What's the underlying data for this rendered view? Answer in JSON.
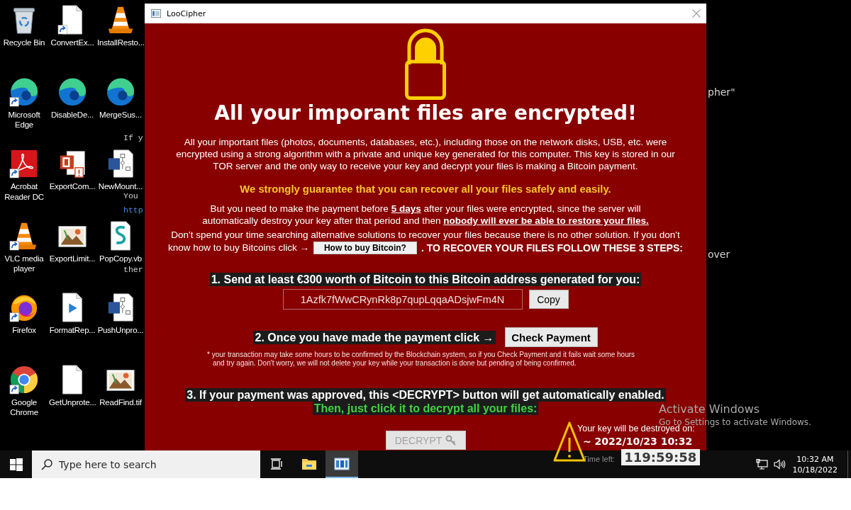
{
  "desktop": {
    "icons": [
      {
        "label": "Recycle Bin",
        "kind": "recycle-bin",
        "shortcut": false
      },
      {
        "label": "ConvertEx...",
        "kind": "file",
        "shortcut": true
      },
      {
        "label": "InstallResto...",
        "kind": "cone",
        "shortcut": false
      },
      {
        "label": "Microsoft Edge",
        "kind": "edge",
        "shortcut": true
      },
      {
        "label": "DisableDe...",
        "kind": "edge",
        "shortcut": false
      },
      {
        "label": "MergeSus...",
        "kind": "edge",
        "shortcut": false
      },
      {
        "label": "Acrobat Reader DC",
        "kind": "acrobat",
        "shortcut": true
      },
      {
        "label": "ExportCom...",
        "kind": "slides",
        "shortcut": false
      },
      {
        "label": "NewMount...",
        "kind": "diagram",
        "shortcut": false
      },
      {
        "label": "VLC media player",
        "kind": "cone",
        "shortcut": true
      },
      {
        "label": "ExportLimit...",
        "kind": "image",
        "shortcut": false
      },
      {
        "label": "PopCopy.vb",
        "kind": "script",
        "shortcut": false
      },
      {
        "label": "Firefox",
        "kind": "firefox",
        "shortcut": true
      },
      {
        "label": "FormatRep...",
        "kind": "media",
        "shortcut": false
      },
      {
        "label": "PushUnpro...",
        "kind": "diagram",
        "shortcut": false
      },
      {
        "label": "Google Chrome",
        "kind": "chrome",
        "shortcut": true
      },
      {
        "label": "GetUnprote...",
        "kind": "file",
        "shortcut": false
      },
      {
        "label": "ReadFind.tif",
        "kind": "image",
        "shortcut": false
      }
    ],
    "background_text": [
      {
        "text": "If y",
        "link": false
      },
      {
        "text": "You",
        "link": false
      },
      {
        "text": "http",
        "link": true
      },
      {
        "text": "ther",
        "link": false
      },
      {
        "text": "pher\"",
        "link": false
      },
      {
        "text": "over",
        "link": false
      }
    ]
  },
  "window": {
    "title": "LooCipher",
    "heading": "All your imporant files are encrypted!",
    "intro": [
      "All your important files (photos, documents, databases, etc.), including those on the network disks, USB, etc. were",
      "encrypted using a strong algorithm with a private and unique key generated for this computer. This key is stored in our",
      "TOR server and the only way to receive your key and decrypt your files is making a Bitcoin payment."
    ],
    "guarantee": "We strongly guarantee that you can recover all your files safely and easily.",
    "deadline": [
      "But you need to make the payment before **5 days** after your files were encrypted, since the server will",
      "automatically destroy your key after that period and then **nobody will ever be able to restore your files.**"
    ],
    "advice": "Don't spend your time searching alternative solutions to recover your files because there is no other solution. If you don't",
    "buy_prompt": "know how to buy Bitcoins click →",
    "buy_button": "How to buy Bitcoin?",
    "steps_intro": ". TO RECOVER YOUR FILES FOLLOW THESE 3 STEPS:",
    "step_1": {
      "text": "1. Send at least €300 worth of Bitcoin to this Bitcoin address generated for you:",
      "address": "1Azfk7fWwCRynRk8p7qupLqqaADsjwFm4N",
      "copy_button": "Copy"
    },
    "step_2": {
      "text": "2. Once you have made the payment click →",
      "button": "Check Payment",
      "note": [
        "* your transaction may take some hours to be confirmed by the Blockchain system, so if you Check Payment and it fails wait some hours",
        "and try again. Don't worry, we will not delete your key while your transaction is done but pending of being confirmed."
      ]
    },
    "step_3": {
      "text": "3. If your payment was approved, this <DECRYPT> button will get automatically enabled.",
      "subtext": "Then, just click it to decrypt all your files:",
      "decrypt_button": {
        "label": "DECRYPT",
        "disabled": true
      }
    },
    "countdown": {
      "label": "Your key will be destroyed on:",
      "deadline": "~ 2022/10/23 10:32",
      "time_left_label": "Time left:",
      "time_left": "119:59:58"
    }
  },
  "activation_notice": {
    "title": "Activate Windows",
    "subtitle": "Go to Settings to activate Windows."
  },
  "taskbar": {
    "search": {
      "placeholder": "Type here to search"
    },
    "apps": [
      {
        "kind": "task-view",
        "selected": false
      },
      {
        "kind": "folder",
        "selected": false
      },
      {
        "kind": "app-window",
        "selected": true
      }
    ],
    "time": "10:32 AM",
    "date": "10/18/2022"
  }
}
